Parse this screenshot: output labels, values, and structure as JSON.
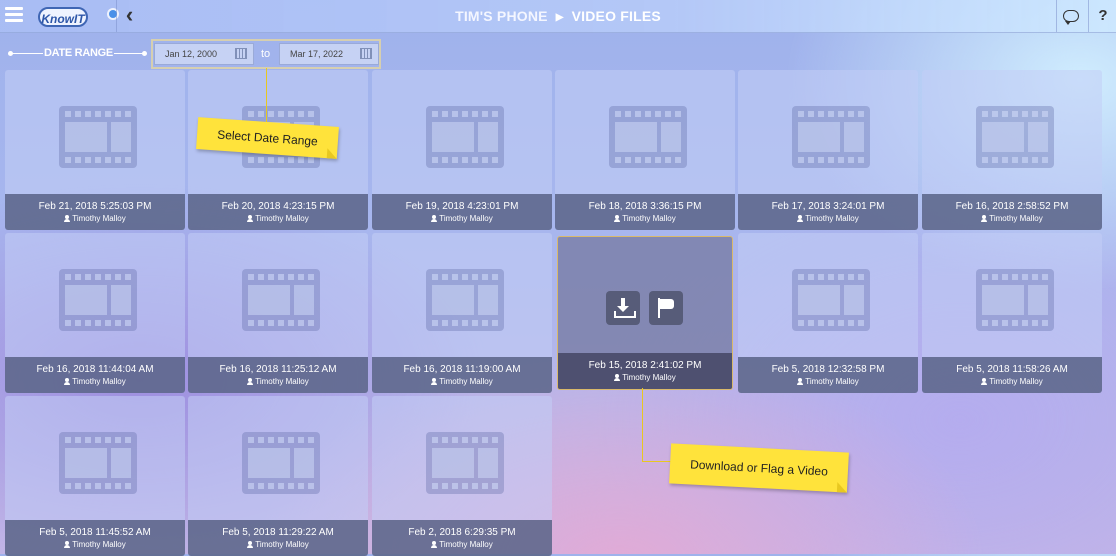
{
  "header": {
    "logo_text": "KnowIT",
    "device": "TIM'S PHONE",
    "current_page": "VIDEO FILES",
    "help_label": "?"
  },
  "date_range": {
    "label": "DATE RANGE",
    "from": "Jan 12, 2000",
    "separator": "to",
    "to": "Mar 17, 2022"
  },
  "videos": [
    {
      "timestamp": "Feb 21, 2018 5:25:03 PM",
      "user": "Timothy Malloy"
    },
    {
      "timestamp": "Feb 20, 2018 4:23:15 PM",
      "user": "Timothy Malloy"
    },
    {
      "timestamp": "Feb 19, 2018 4:23:01 PM",
      "user": "Timothy Malloy"
    },
    {
      "timestamp": "Feb 18, 2018 3:36:15 PM",
      "user": "Timothy Malloy"
    },
    {
      "timestamp": "Feb 17, 2018 3:24:01 PM",
      "user": "Timothy Malloy"
    },
    {
      "timestamp": "Feb 16, 2018 2:58:52 PM",
      "user": "Timothy Malloy"
    },
    {
      "timestamp": "Feb 16, 2018 11:44:04 AM",
      "user": "Timothy Malloy"
    },
    {
      "timestamp": "Feb 16, 2018 11:25:12 AM",
      "user": "Timothy Malloy"
    },
    {
      "timestamp": "Feb 16, 2018 11:19:00 AM",
      "user": "Timothy Malloy"
    },
    {
      "timestamp": "Feb 15, 2018 2:41:02 PM",
      "user": "Timothy Malloy",
      "selected": true
    },
    {
      "timestamp": "Feb 5, 2018 12:32:58 PM",
      "user": "Timothy Malloy"
    },
    {
      "timestamp": "Feb 5, 2018 11:58:26 AM",
      "user": "Timothy Malloy"
    },
    {
      "timestamp": "Feb 5, 2018 11:45:52 AM",
      "user": "Timothy Malloy"
    },
    {
      "timestamp": "Feb 5, 2018 11:29:22 AM",
      "user": "Timothy Malloy"
    },
    {
      "timestamp": "Feb 2, 2018 6:29:35 PM",
      "user": "Timothy Malloy"
    }
  ],
  "callouts": {
    "date_range": "Select Date Range",
    "actions": "Download or Flag a Video"
  },
  "icons": {
    "menu": "hamburger-icon",
    "back": "chevron-left-icon",
    "chat": "chat-icon",
    "help": "help-icon",
    "calendar": "calendar-icon",
    "video": "film-icon",
    "user": "user-icon",
    "download": "download-icon",
    "flag": "flag-icon"
  },
  "colors": {
    "callout": "#ffe33b",
    "caption_bg": "#46507380",
    "selected_border": "#d9b96a"
  }
}
